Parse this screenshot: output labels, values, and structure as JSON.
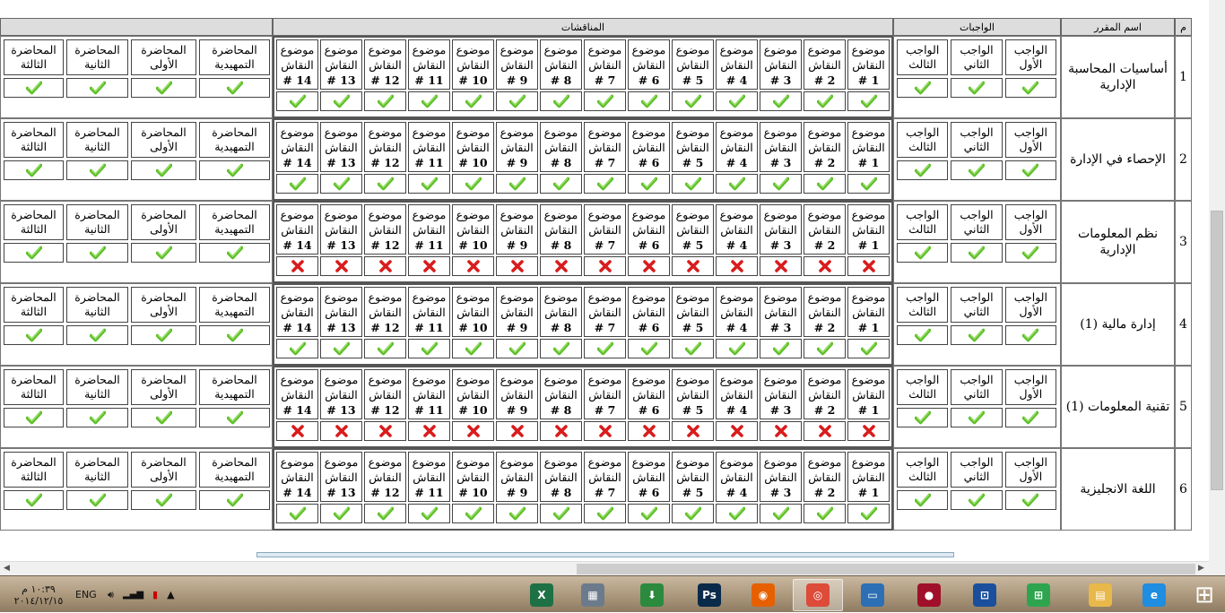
{
  "header": {
    "num": "م",
    "course": "اسم المقرر",
    "assignments": "الواجبات",
    "discussions": "المناقشات"
  },
  "assignment_labels": [
    [
      "الواجب",
      "الأول"
    ],
    [
      "الواجب",
      "الثاني"
    ],
    [
      "الواجب",
      "الثالث"
    ]
  ],
  "discussion_word1": "موضوع",
  "discussion_word2": "النقاش",
  "discussion_nums": [
    "1 #",
    "2 #",
    "3 #",
    "4 #",
    "5 #",
    "6 #",
    "7 #",
    "8 #",
    "9 #",
    "10 #",
    "11 #",
    "12 #",
    "13 #",
    "14 #"
  ],
  "lecture_labels": [
    [
      "المحاضرة",
      "التمهيدية"
    ],
    [
      "المحاضرة",
      "الأولى"
    ],
    [
      "المحاضرة",
      "الثانية"
    ],
    [
      "المحاضرة",
      "الثالثة"
    ]
  ],
  "courses": [
    {
      "num": "1",
      "name_lines": [
        "أساسيات المحاسبة",
        "الإدارية"
      ],
      "discussions_status": "done"
    },
    {
      "num": "2",
      "name_lines": [
        "الإحصاء في الإدارة"
      ],
      "discussions_status": "done"
    },
    {
      "num": "3",
      "name_lines": [
        "نظم المعلومات الإدارية"
      ],
      "discussions_status": "missing"
    },
    {
      "num": "4",
      "name_lines": [
        "إدارة مالية (1)"
      ],
      "discussions_status": "done"
    },
    {
      "num": "5",
      "name_lines": [
        "تقنية المعلومات (1)"
      ],
      "discussions_status": "missing"
    },
    {
      "num": "6",
      "name_lines": [
        "اللغة الانجليزية"
      ],
      "discussions_status": "done"
    }
  ],
  "colors": {
    "check": "#5fbf2a",
    "cross": "#d91c1c"
  },
  "taskbar": {
    "apps": [
      "excel-icon",
      "calculator-icon",
      "internet-download-manager-icon",
      "photoshop-icon",
      "firefox-icon",
      "chrome-icon",
      "remote-desktop-icon",
      "media-player-icon",
      "network-admin-icon",
      "store-icon",
      "file-explorer-icon",
      "internet-explorer-icon",
      "windows-icon"
    ],
    "language": "ENG",
    "time": "١٠:٣٩ م",
    "date": "٢٠١٤/١٢/١٥"
  }
}
